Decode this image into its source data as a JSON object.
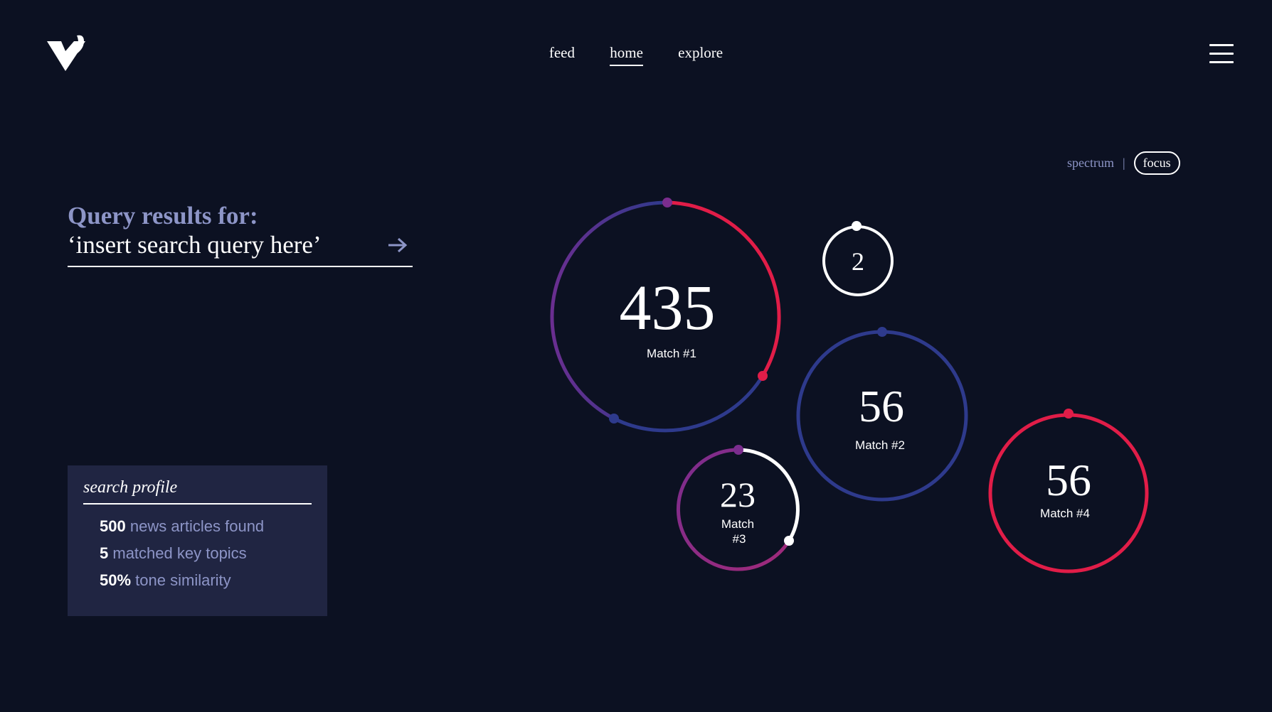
{
  "nav": {
    "items": [
      {
        "label": "feed",
        "active": false
      },
      {
        "label": "home",
        "active": true
      },
      {
        "label": "explore",
        "active": false
      }
    ]
  },
  "view_toggle": {
    "option_1": "spectrum",
    "option_2": "focus",
    "selected": "focus"
  },
  "query": {
    "heading": "Query results for:",
    "text": "‘insert search query here’"
  },
  "search_profile": {
    "title": "search profile",
    "stats": [
      {
        "value": "500",
        "label": "news articles found"
      },
      {
        "value": "5",
        "label": "matched key topics"
      },
      {
        "value": "50%",
        "label": "tone similarity"
      }
    ]
  },
  "matches": [
    {
      "count": "435",
      "label": "Match #1"
    },
    {
      "count": "2",
      "label": ""
    },
    {
      "count": "56",
      "label": "Match #2"
    },
    {
      "count": "23",
      "label_line1": "Match",
      "label_line2": "#3"
    },
    {
      "count": "56",
      "label": "Match #4"
    }
  ],
  "colors": {
    "background": "#0c1122",
    "accent_red": "#e11d48",
    "accent_purple": "#7b2d8e",
    "accent_blue": "#2e3a8c",
    "muted_text": "#8d95c7",
    "panel": "#202542"
  }
}
